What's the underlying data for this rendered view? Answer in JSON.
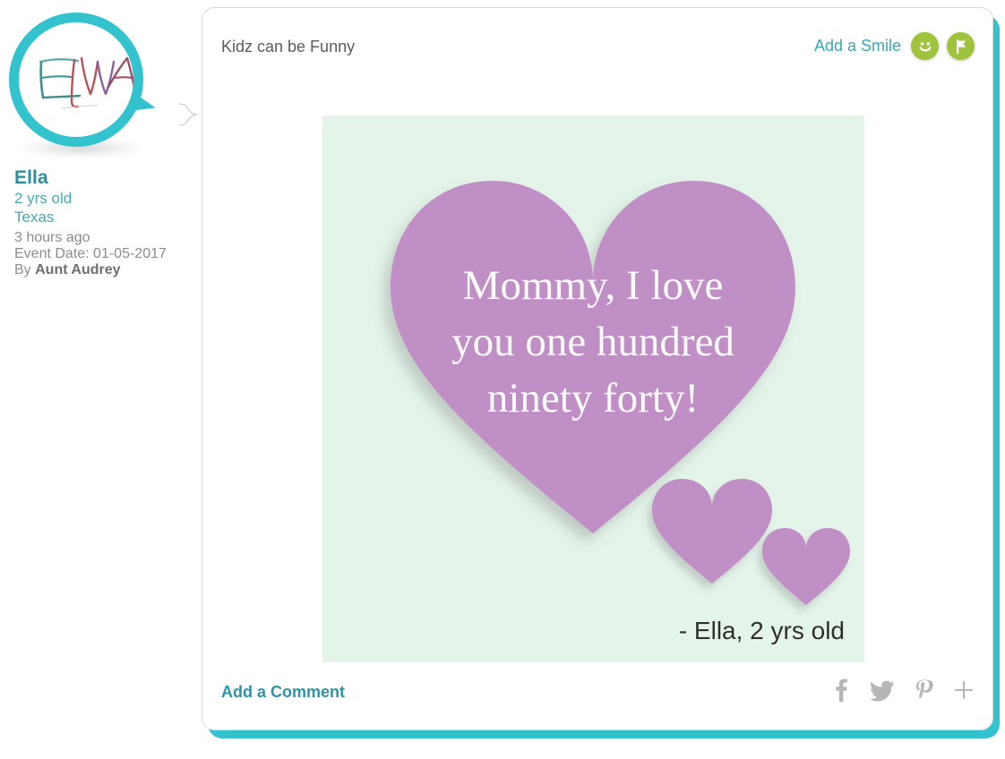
{
  "theme": {
    "teal": "#32c3ce",
    "teal_dark": "#2a8f9e",
    "teal_link": "#3aa8b4",
    "green_badge": "#9fc33c",
    "gray_text": "#8c8c8c",
    "title_gray": "#5b5b5b",
    "share_gray": "#b6b6b6",
    "media_bg": "#e4f4e9",
    "heart_purple": "#c08fc6"
  },
  "sidebar": {
    "avatar": {
      "icon": "avatar-drawing-ella",
      "alt_text": "ELLA"
    },
    "profile": {
      "name": "Ella",
      "age": "2 yrs old",
      "location": "Texas",
      "posted_ago": "3 hours ago",
      "event_date": "Event Date: 01-05-2017",
      "byline_prefix": "By ",
      "byline_author": "Aunt Audrey"
    }
  },
  "card": {
    "header": {
      "title": "Kidz can be Funny",
      "add_smile_label": "Add a Smile",
      "smile_icon": "smiley-face-icon",
      "flag_icon": "flag-icon"
    },
    "media": {
      "quote_line_1": "Mommy, I love",
      "quote_line_2": "you one hundred",
      "quote_line_3": "ninety forty!",
      "attribution": "- Ella, 2 yrs old"
    },
    "footer": {
      "add_comment_label": "Add a Comment",
      "share": [
        {
          "icon": "facebook-icon",
          "glyph": "f"
        },
        {
          "icon": "twitter-icon",
          "glyph": "t"
        },
        {
          "icon": "pinterest-icon",
          "glyph": "P"
        },
        {
          "icon": "plus-icon",
          "glyph": "+"
        }
      ]
    }
  }
}
